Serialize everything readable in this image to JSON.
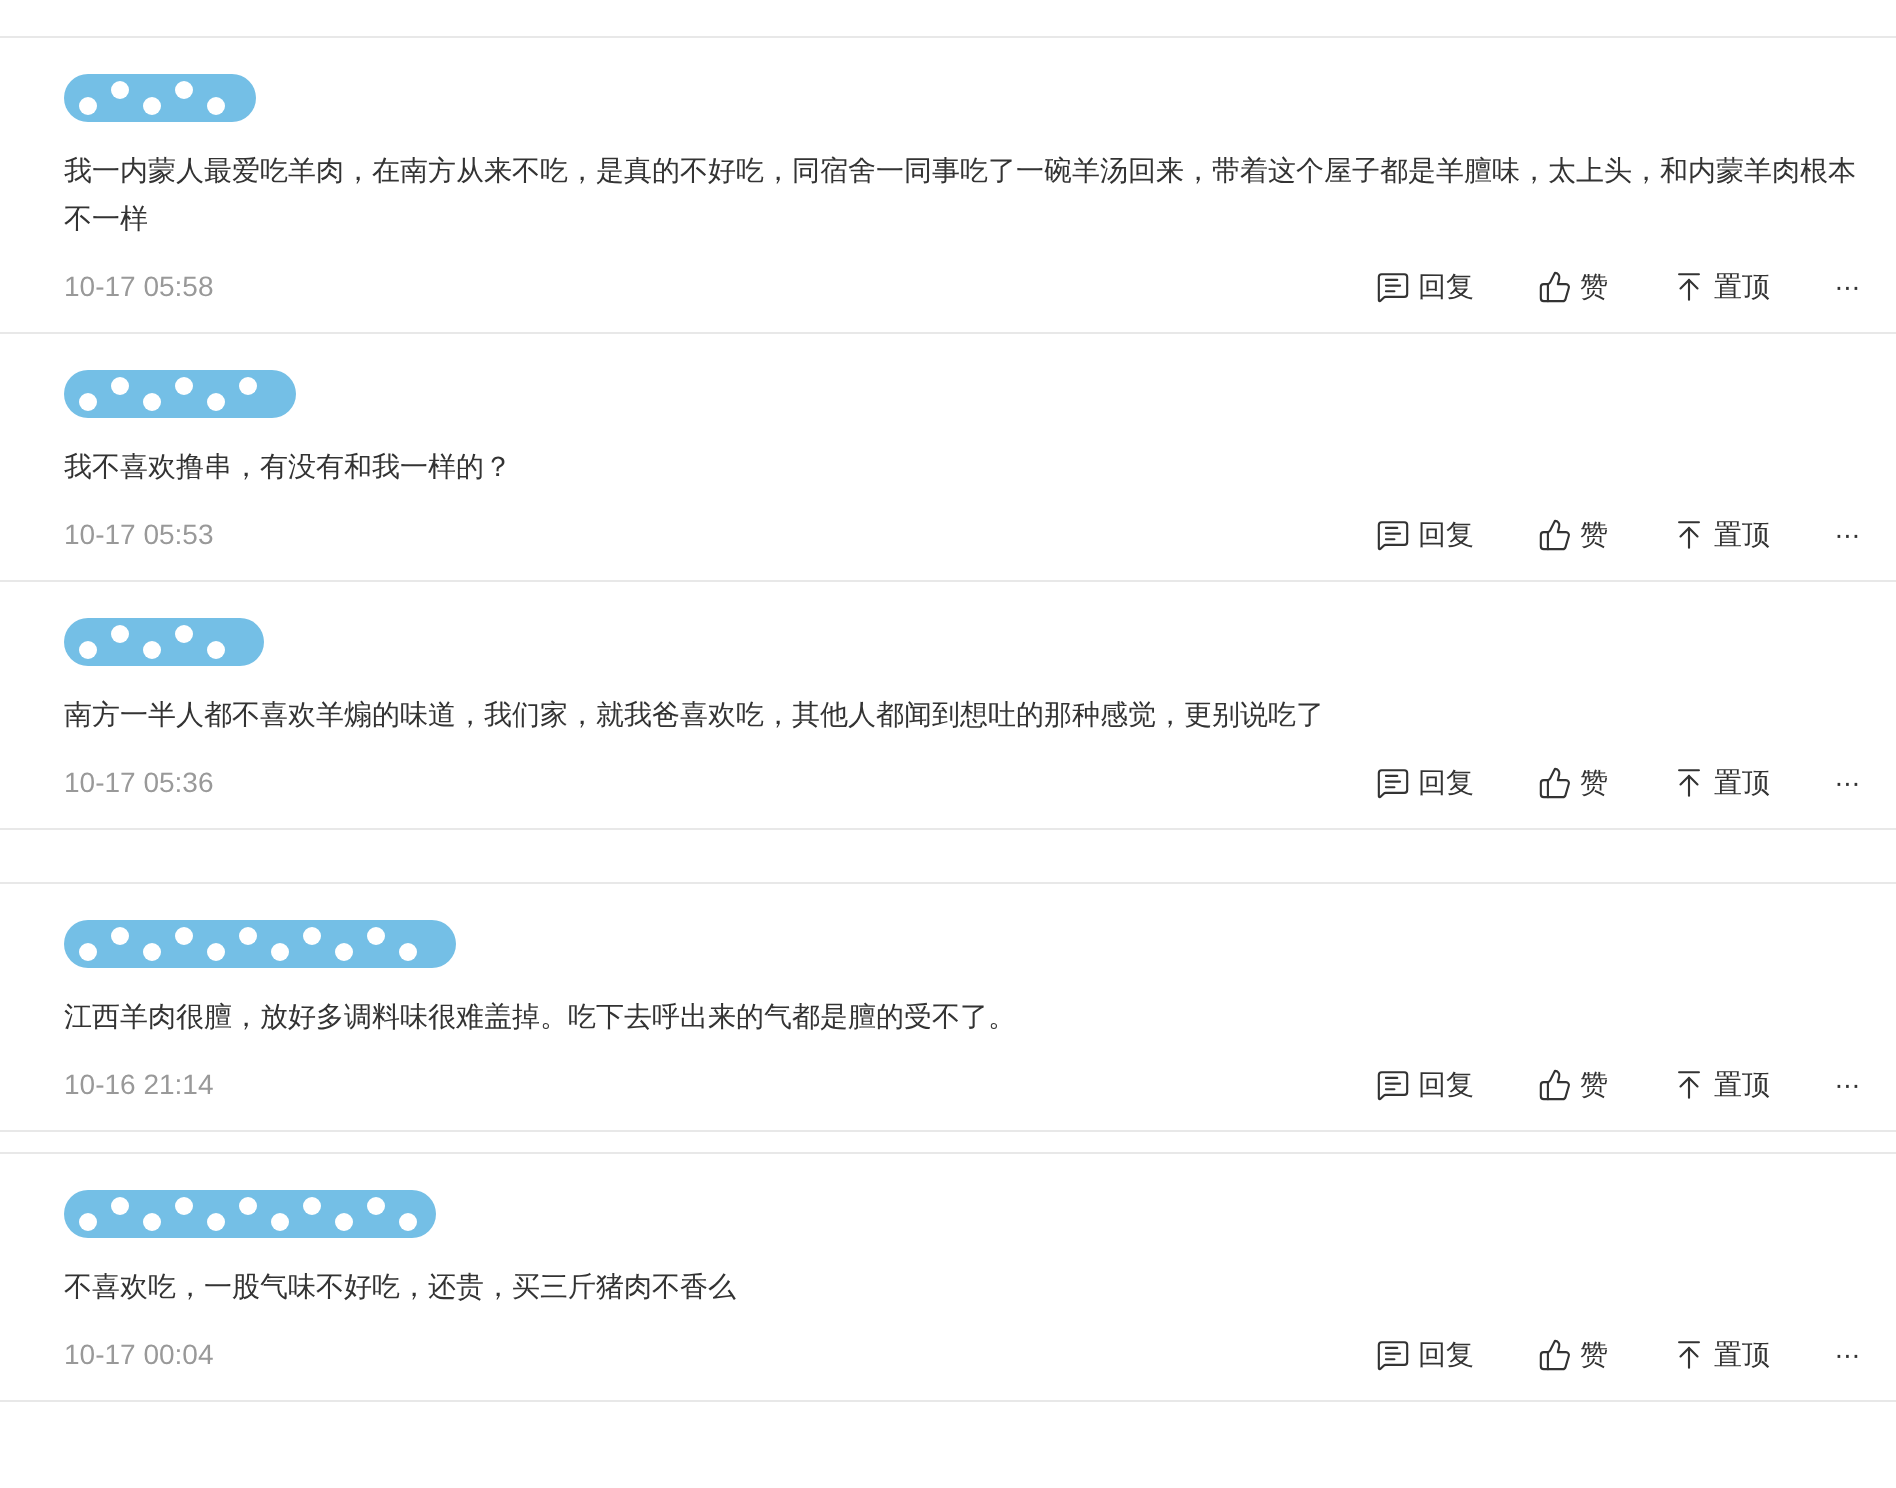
{
  "sections": [
    {
      "comments": [
        {
          "text": "我一内蒙人最爱吃羊肉，在南方从来不吃，是真的不好吃，同宿舍一同事吃了一碗羊汤回来，带着这个屋子都是羊膻味，太上头，和内蒙羊肉根本不一样",
          "time": "10-17 05:58",
          "actions": [
            "回复",
            "赞",
            "置顶"
          ],
          "more": "···"
        },
        {
          "text": "我不喜欢撸串，有没有和我一样的？",
          "time": "10-17 05:53",
          "actions": [
            "回复",
            "赞",
            "置顶"
          ],
          "more": "···"
        },
        {
          "text": "南方一半人都不喜欢羊煽的味道，我们家，就我爸喜欢吃，其他人都闻到想吐的那种感觉，更别说吃了",
          "time": "10-17 05:36",
          "actions": [
            "回复",
            "赞",
            "置顶"
          ],
          "more": "···"
        }
      ]
    },
    {
      "comments": [
        {
          "text": "江西羊肉很膻，放好多调料味很难盖掉。吃下去呼出来的气都是膻的受不了。",
          "time": "10-16 21:14",
          "actions": [
            "回复",
            "赞",
            "置顶"
          ],
          "more": "···"
        }
      ]
    },
    {
      "comments": [
        {
          "text": "不喜欢吃，一股气味不好吃，还贵，买三斤猪肉不香么",
          "time": "10-17 00:04",
          "actions": [
            "回复",
            "赞",
            "置顶"
          ],
          "more": "···"
        }
      ]
    }
  ]
}
